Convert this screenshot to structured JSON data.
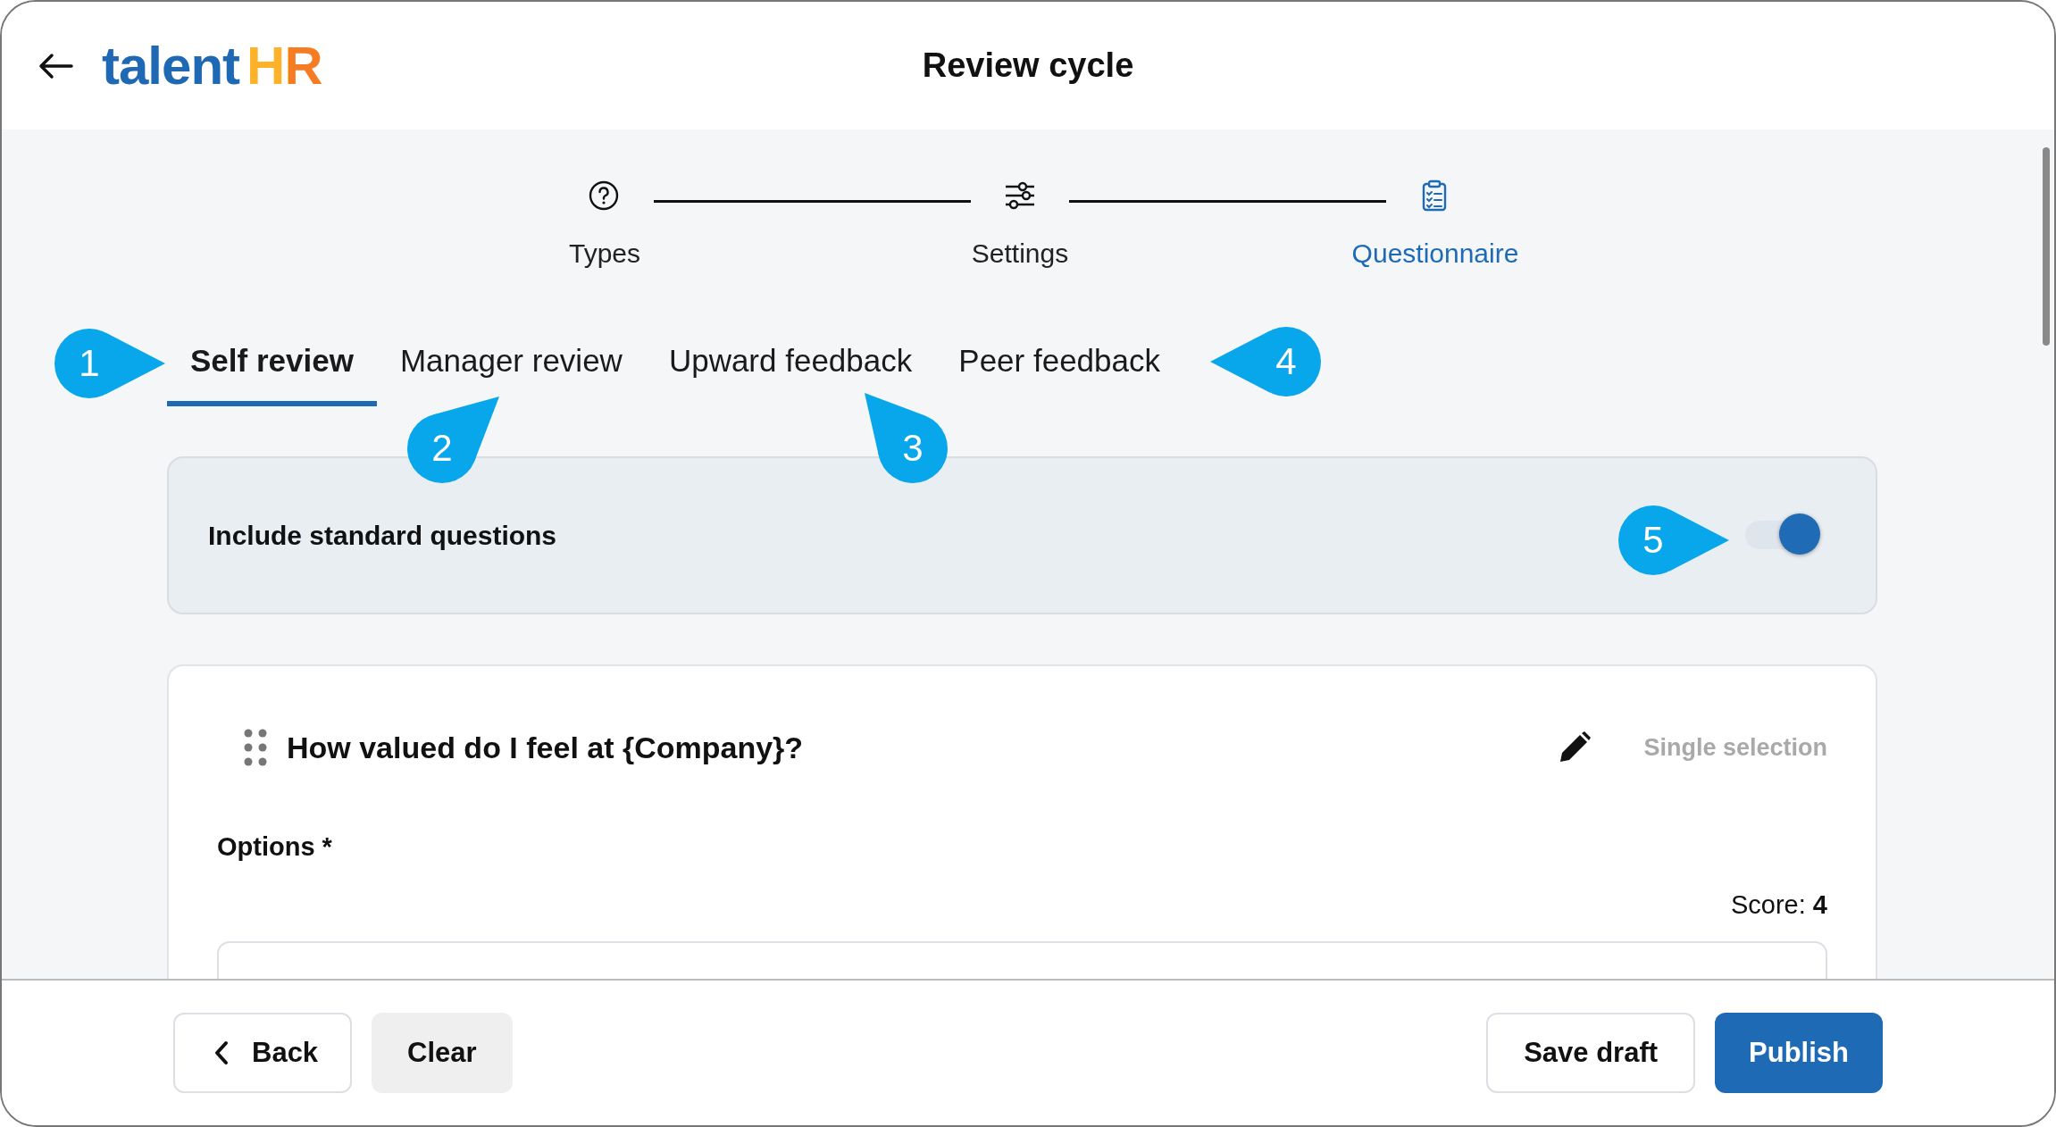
{
  "header": {
    "logo": {
      "text": "talent",
      "accent": "HR"
    },
    "title": "Review cycle"
  },
  "steps": [
    {
      "label": "Types",
      "selected": false
    },
    {
      "label": "Settings",
      "selected": false
    },
    {
      "label": "Questionnaire",
      "selected": true
    }
  ],
  "tabs": [
    {
      "label": "Self review",
      "selected": true
    },
    {
      "label": "Manager review",
      "selected": false
    },
    {
      "label": "Upward feedback",
      "selected": false
    },
    {
      "label": "Peer feedback",
      "selected": false
    }
  ],
  "standard_questions": {
    "label": "Include standard questions",
    "on": true
  },
  "question": {
    "title": "How valued do I feel at {Company}?",
    "type": "Single selection",
    "options_label": "Options *",
    "score": "Score: **4**"
  },
  "footer": {
    "buttons": [
      {
        "label": "Back",
        "kind": "back"
      },
      {
        "label": "Clear",
        "kind": "clear"
      },
      {
        "label": "Save draft",
        "kind": "outline"
      },
      {
        "label": "Publish",
        "kind": "primary"
      }
    ]
  },
  "callouts": [
    {
      "number": "1"
    },
    {
      "number": "2"
    },
    {
      "number": "3"
    },
    {
      "number": "4"
    },
    {
      "number": "5"
    }
  ]
}
